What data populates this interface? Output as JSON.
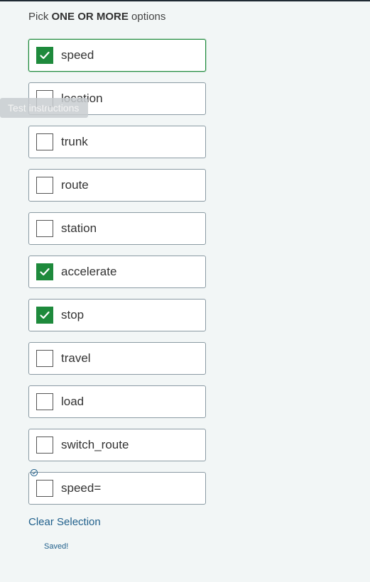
{
  "prompt": {
    "prefix": "Pick ",
    "emphasis": "ONE OR MORE",
    "suffix": " options"
  },
  "options": [
    {
      "label": "speed",
      "checked": true
    },
    {
      "label": "location",
      "checked": false
    },
    {
      "label": "trunk",
      "checked": false
    },
    {
      "label": "route",
      "checked": false
    },
    {
      "label": "station",
      "checked": false
    },
    {
      "label": "accelerate",
      "checked": true
    },
    {
      "label": "stop",
      "checked": true
    },
    {
      "label": "travel",
      "checked": false
    },
    {
      "label": "load",
      "checked": false
    },
    {
      "label": "switch_route",
      "checked": false
    },
    {
      "label": "speed=",
      "checked": false
    }
  ],
  "tooltip": {
    "text": "Test instructions"
  },
  "clear_selection": {
    "label": "Clear Selection"
  },
  "status": {
    "text": "Saved!"
  },
  "colors": {
    "accent_green": "#1e8a3c",
    "link_blue": "#1f5f8b",
    "background": "#f2f6f6"
  }
}
